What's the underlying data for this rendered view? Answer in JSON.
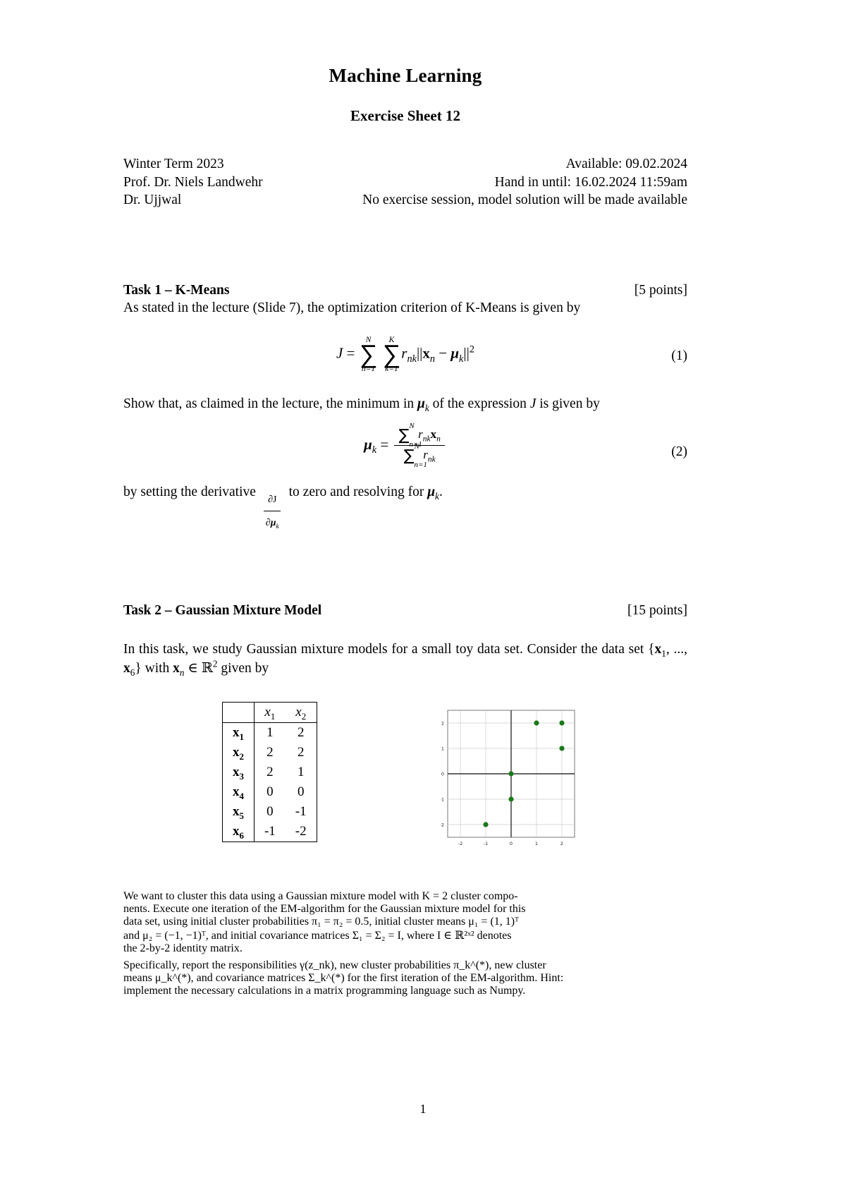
{
  "document": {
    "title": "Machine Learning",
    "subtitle": "Exercise Sheet 12",
    "page_number": "1"
  },
  "meta": {
    "left": [
      "Winter Term 2023",
      "Prof. Dr. Niels Landwehr",
      "Dr. Ujjwal"
    ],
    "right": [
      "Available: 09.02.2024",
      "Hand in until: 16.02.2024 11:59am",
      "No exercise session, model solution will be made available"
    ]
  },
  "task1": {
    "heading": "Task 1 – K-Means",
    "points": "[5 points]",
    "intro": "As stated in the lecture (Slide 7), the optimization criterion of K-Means is given by",
    "equation1": {
      "number": "(1)",
      "lhs": "J",
      "eq": "=",
      "sum1_upper": "N",
      "sum1_lower": "n=1",
      "sum2_upper": "K",
      "sum2_lower": "k=1",
      "term_r": "r",
      "term_r_sub": "nk",
      "norm_open": "||",
      "x": "x",
      "x_sub": "n",
      "minus": "−",
      "mu": "μ",
      "mu_sub": "k",
      "norm_close": "||",
      "power": "2"
    },
    "mid_text_a": "Show that, as claimed in the lecture, the minimum in ",
    "mid_text_b": " of the expression ",
    "mid_text_c": " is given by",
    "equation2": {
      "number": "(2)",
      "lhs_mu": "μ",
      "lhs_sub": "k",
      "eq": "=",
      "num_sum_upper": "N",
      "num_sum_lower": "n=1",
      "num_r": "r",
      "num_r_sub": "nk",
      "num_x": "x",
      "num_x_sub": "n",
      "den_sum_upper": "N",
      "den_sum_lower": "n=1",
      "den_r": "r",
      "den_r_sub": "nk"
    },
    "closing_a": "by setting the derivative ",
    "closing_deriv_num": "∂J",
    "closing_deriv_den": "∂μ",
    "closing_deriv_den_sub": "k",
    "closing_b": " to zero and resolving for ",
    "closing_mu": "μ",
    "closing_mu_sub": "k",
    "closing_c": "."
  },
  "task2": {
    "heading": "Task 2 – Gaussian Mixture Model",
    "points": "[15 points]",
    "intro_a": "In this task, we study Gaussian mixture models for a small toy data set.  Consider the data set {",
    "intro_x1": "x",
    "intro_x1_sub": "1",
    "intro_dots": ", ..., ",
    "intro_x6": "x",
    "intro_x6_sub": "6",
    "intro_b": "} with ",
    "intro_xn": "x",
    "intro_xn_sub": "n",
    "intro_in": " ∈ ℝ",
    "intro_pow": "2",
    "intro_c": " given by",
    "table": {
      "corner": "",
      "columns": [
        "x",
        "x"
      ],
      "column_subs": [
        "1",
        "2"
      ],
      "rows": [
        {
          "label": "x",
          "label_sub": "1",
          "x1": "1",
          "x2": "2"
        },
        {
          "label": "x",
          "label_sub": "2",
          "x1": "2",
          "x2": "2"
        },
        {
          "label": "x",
          "label_sub": "3",
          "x1": "2",
          "x2": "1"
        },
        {
          "label": "x",
          "label_sub": "4",
          "x1": "0",
          "x2": "0"
        },
        {
          "label": "x",
          "label_sub": "5",
          "x1": "0",
          "x2": "-1"
        },
        {
          "label": "x",
          "label_sub": "6",
          "x1": "-1",
          "x2": "-2"
        }
      ]
    },
    "paragraph_lines": [
      "We want to cluster this data using a Gaussian mixture model with K = 2 cluster compo-",
      "nents.  Execute one iteration of the EM-algorithm for the Gaussian mixture model for this",
      "data set, using initial cluster probabilities π₁ = π₂ = 0.5, initial cluster means μ₁ = (1, 1)ᵀ",
      "and μ₂ = (−1, −1)ᵀ, and initial covariance matrices Σ₁ = Σ₂ = I, where I ∈ ℝ²ˣ² denotes",
      "the 2-by-2 identity matrix."
    ],
    "paragraph2_lines": [
      "Specifically, report the responsibilities γ(z_nk), new cluster probabilities π_k^(*), new cluster",
      "means μ_k^(*), and covariance matrices Σ_k^(*) for the first iteration of the EM-algorithm.  Hint:",
      "implement the necessary calculations in a matrix programming language such as Numpy."
    ]
  },
  "chart_data": {
    "type": "scatter",
    "title": "",
    "xlabel": "",
    "ylabel": "",
    "xlim": [
      -2.5,
      2.5
    ],
    "ylim": [
      -2.5,
      2.5
    ],
    "xticks": [
      "-2",
      "-1",
      "0",
      "1",
      "2"
    ],
    "yticks": [
      "-2",
      "-1",
      "0",
      "1",
      "2"
    ],
    "grid": true,
    "point_color": "#1a7a1a",
    "points": [
      {
        "x": 1,
        "y": 2
      },
      {
        "x": 2,
        "y": 2
      },
      {
        "x": 2,
        "y": 1
      },
      {
        "x": 0,
        "y": 0
      },
      {
        "x": 0,
        "y": -1
      },
      {
        "x": -1,
        "y": -2
      }
    ]
  }
}
